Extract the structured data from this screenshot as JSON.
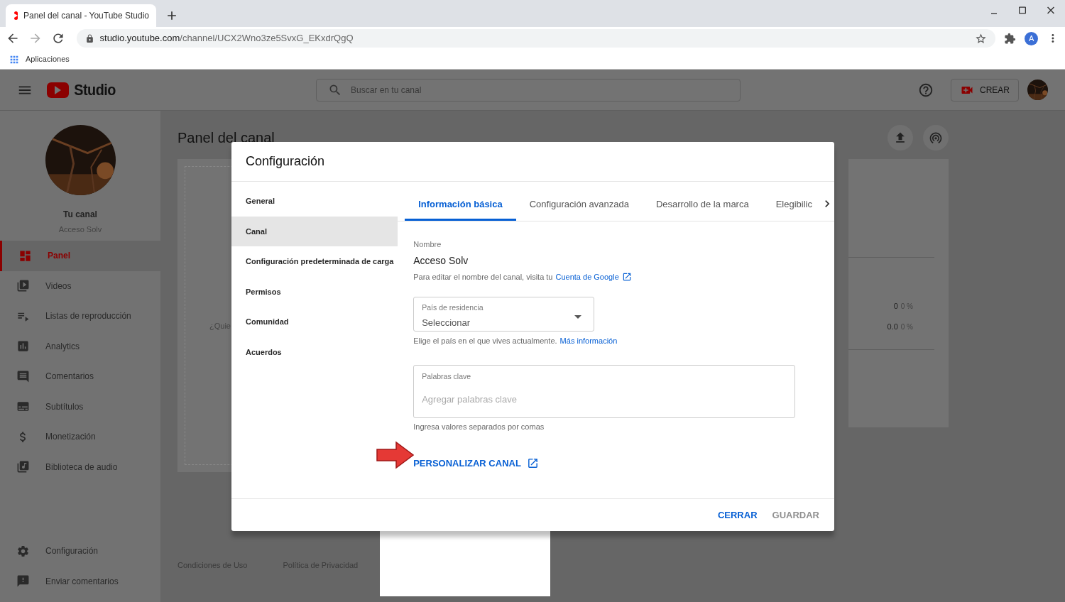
{
  "browser": {
    "tab_title": "Panel del canal - YouTube Studio",
    "url_host": "studio.youtube.com",
    "url_path": "/channel/UCX2Wno3ze5SvxG_EKxdrQgQ",
    "bookmarks": [
      "Aplicaciones"
    ],
    "profile_initial": "A"
  },
  "header": {
    "logo_text": "Studio",
    "search_placeholder": "Buscar en tu canal",
    "create_label": "CREAR"
  },
  "sidebar": {
    "channel_title": "Tu canal",
    "channel_name": "Acceso Solv",
    "items": [
      {
        "label": "Panel",
        "kind": "dashboard",
        "selected": true
      },
      {
        "label": "Videos",
        "kind": "videos",
        "selected": false
      },
      {
        "label": "Listas de reproducción",
        "kind": "playlists",
        "selected": false
      },
      {
        "label": "Analytics",
        "kind": "analytics",
        "selected": false
      },
      {
        "label": "Comentarios",
        "kind": "comments",
        "selected": false
      },
      {
        "label": "Subtítulos",
        "kind": "subtitles",
        "selected": false
      },
      {
        "label": "Monetización",
        "kind": "money",
        "selected": false
      },
      {
        "label": "Biblioteca de audio",
        "kind": "audio",
        "selected": false
      }
    ],
    "bottom_items": [
      {
        "label": "Configuración",
        "kind": "settings"
      },
      {
        "label": "Enviar comentarios",
        "kind": "feedback"
      }
    ]
  },
  "main": {
    "title": "Panel del canal",
    "card_snippet": "¿Quie",
    "stats": [
      {
        "value": "0",
        "change": "0 %"
      },
      {
        "value": "0.0",
        "change": "0 %"
      }
    ],
    "footer_links": [
      "Condiciones de Uso",
      "Política de Privacidad"
    ]
  },
  "dialog": {
    "title": "Configuración",
    "nav": [
      {
        "label": "General",
        "selected": false
      },
      {
        "label": "Canal",
        "selected": true
      },
      {
        "label": "Configuración predeterminada de carga",
        "selected": false
      },
      {
        "label": "Permisos",
        "selected": false
      },
      {
        "label": "Comunidad",
        "selected": false
      },
      {
        "label": "Acuerdos",
        "selected": false
      }
    ],
    "tabs": [
      {
        "label": "Información básica",
        "selected": true
      },
      {
        "label": "Configuración avanzada",
        "selected": false
      },
      {
        "label": "Desarrollo de la marca",
        "selected": false
      },
      {
        "label": "Elegibilic",
        "selected": false
      }
    ],
    "name_label": "Nombre",
    "name_value": "Acceso Solv",
    "name_help": "Para editar el nombre del canal, visita tu",
    "name_link": "Cuenta de Google",
    "country_label": "País de residencia",
    "country_value": "Seleccionar",
    "country_help": "Elige el país en el que vives actualmente.",
    "country_link": "Más información",
    "keywords_label": "Palabras clave",
    "keywords_placeholder": "Agregar palabras clave",
    "keywords_help": "Ingresa valores separados por comas",
    "customize_link": "PERSONALIZAR CANAL",
    "buttons": [
      {
        "label": "CERRAR",
        "disabled": false
      },
      {
        "label": "GUARDAR",
        "disabled": true
      }
    ]
  }
}
